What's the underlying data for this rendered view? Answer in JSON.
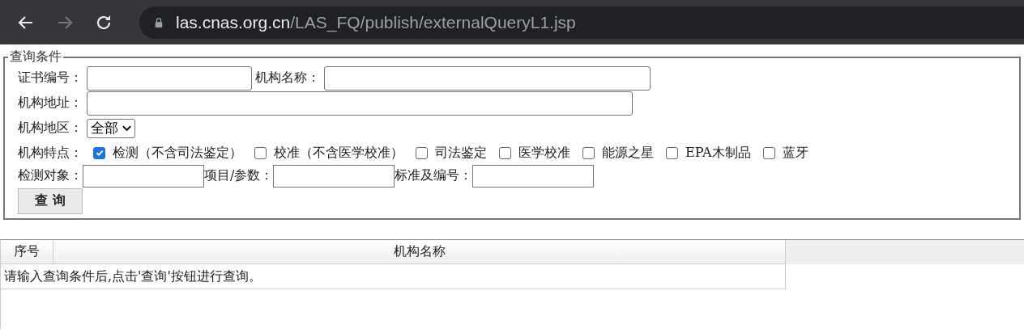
{
  "browser": {
    "back_enabled": true,
    "forward_enabled": false,
    "url_host": "las.cnas.org.cn",
    "url_path": "/LAS_FQ/publish/externalQueryL1.jsp"
  },
  "query": {
    "legend": "查询条件",
    "cert_label": "证书编号：",
    "name_label": "机构名称：",
    "address_label": "机构地址：",
    "region_label": "机构地区：",
    "region_value": "全部",
    "features_label": "机构特点：",
    "features": [
      {
        "label": "检测（不含司法鉴定）",
        "checked": true
      },
      {
        "label": "校准（不含医学校准）",
        "checked": false
      },
      {
        "label": "司法鉴定",
        "checked": false
      },
      {
        "label": "医学校准",
        "checked": false
      },
      {
        "label": "能源之星",
        "checked": false
      },
      {
        "label": "EPA木制品",
        "checked": false
      },
      {
        "label": "蓝牙",
        "checked": false
      }
    ],
    "object_label": "检测对象：",
    "param_label": "项目/参数：",
    "standard_label": "标准及编号：",
    "submit": "查 询"
  },
  "table": {
    "columns": [
      "序号",
      "机构名称"
    ],
    "message": "请输入查询条件后,点击'查询'按钮进行查询。"
  }
}
